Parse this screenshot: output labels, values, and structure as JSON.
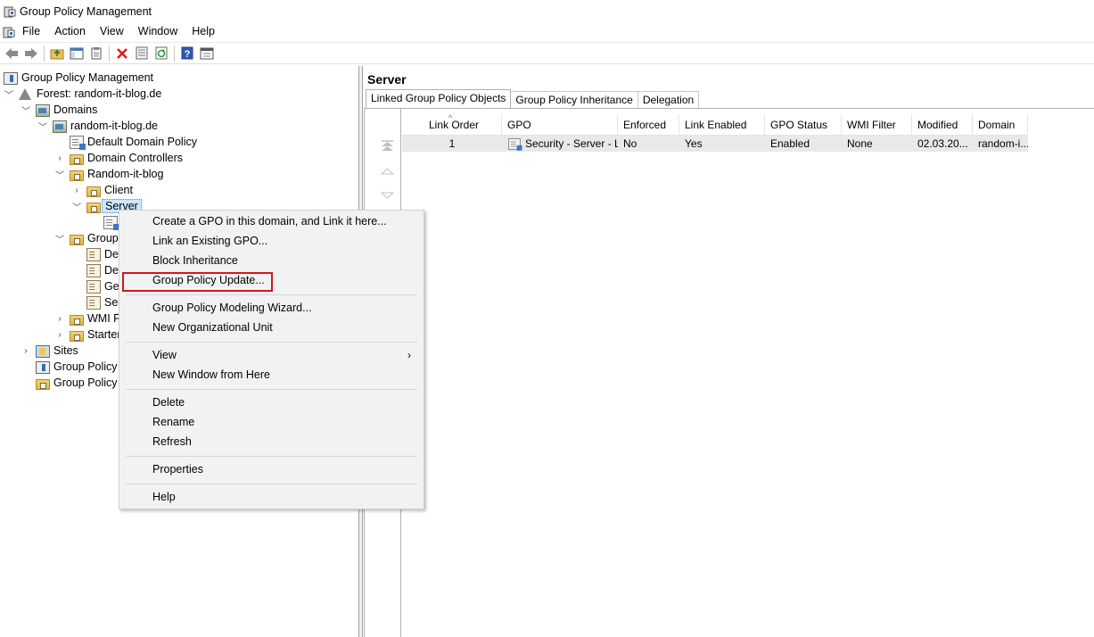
{
  "window": {
    "title": "Group Policy Management"
  },
  "menubar": {
    "items": [
      "File",
      "Action",
      "View",
      "Window",
      "Help"
    ]
  },
  "toolbar": {
    "buttons": [
      "back-icon",
      "forward-icon",
      "folder-up-icon",
      "show-hide-tree-icon",
      "clipboard-icon",
      "delete-icon",
      "properties-icon",
      "refresh-icon",
      "help-icon",
      "console-icon"
    ]
  },
  "tree": {
    "root": "Group Policy Management",
    "forest": "Forest: random-it-blog.de",
    "domains": "Domains",
    "domain": "random-it-blog.de",
    "default_domain_policy": "Default Domain Policy",
    "domain_controllers": "Domain Controllers",
    "ou_random": "Random-it-blog",
    "ou_client": "Client",
    "ou_server": "Server",
    "group_policy_objects": "Group",
    "gpo_1": "De",
    "gpo_2": "De",
    "gpo_3": "Ge",
    "gpo_4": "Sec",
    "wmi_filters": "WMI F",
    "starter_gpos": "Starter",
    "sites": "Sites",
    "gp_modeling": "Group Policy",
    "gp_results": "Group Policy"
  },
  "right": {
    "title": "Server",
    "tabs": [
      "Linked Group Policy Objects",
      "Group Policy Inheritance",
      "Delegation"
    ],
    "columns": [
      "Link Order",
      "GPO",
      "Enforced",
      "Link Enabled",
      "GPO Status",
      "WMI Filter",
      "Modified",
      "Domain"
    ],
    "rows": [
      [
        "1",
        "Security - Server - L...",
        "No",
        "Yes",
        "Enabled",
        "None",
        "02.03.20...",
        "random-i..."
      ]
    ]
  },
  "context_menu": {
    "items": [
      "Create a GPO in this domain, and Link it here...",
      "Link an Existing GPO...",
      "Block Inheritance",
      "Group Policy Update...",
      "Group Policy Modeling Wizard...",
      "New Organizational Unit",
      "View",
      "New Window from Here",
      "Delete",
      "Rename",
      "Refresh",
      "Properties",
      "Help"
    ],
    "submenu_arrow": "›"
  },
  "colors": {
    "highlight_box": "#d0181e",
    "selection": "#cce8ff"
  }
}
